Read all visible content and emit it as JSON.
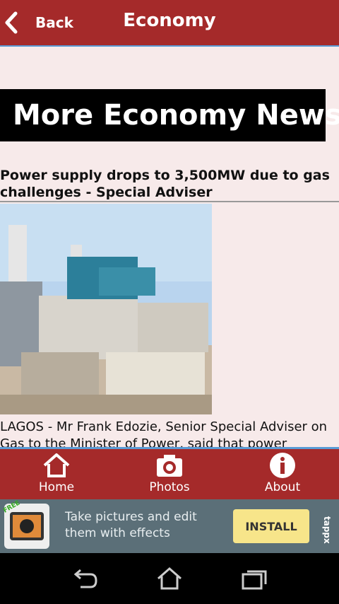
{
  "header": {
    "back_label": "Back",
    "title": "Economy"
  },
  "content": {
    "banner_title": "More Economy News",
    "headline": "Power supply drops to 3,500MW due to gas challenges - Special Adviser",
    "summary": "LAGOS - Mr Frank Edozie, Senior Special Adviser on Gas to the Minister of Power, said that power"
  },
  "bottom_nav": {
    "home_label": "Home",
    "photos_label": "Photos",
    "about_label": "About"
  },
  "ad": {
    "badge": "FREE",
    "text": "Take pictures and edit them with effects",
    "install_label": "INSTALL",
    "brand": "tappx"
  },
  "colors": {
    "header": "#a52a2a",
    "content_bg": "#f7eaea",
    "accent_line": "#5a9bd5",
    "install_button": "#f7e58a"
  }
}
